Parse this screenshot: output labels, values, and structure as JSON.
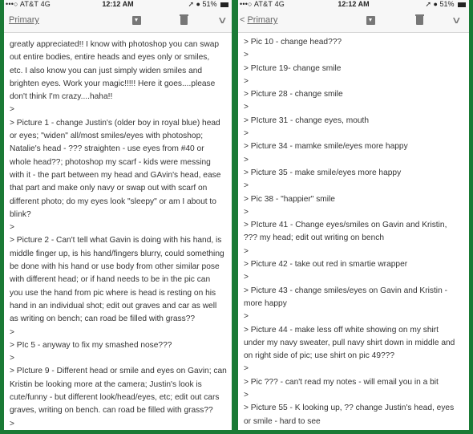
{
  "screens": [
    {
      "status_bar": {
        "carrier": "•••○ AT&T  4G",
        "time": "12:12 AM",
        "battery": "51%"
      },
      "nav": {
        "back_label": "Primary"
      },
      "lines": [
        "greatly appreciated!!  I know with photoshop you can swap",
        "out entire bodies, entire heads and eyes only or smiles,",
        "etc.  I also know you can just simply widen smiles and",
        "brighten eyes.  Work your magic!!!!!  Here it goes....please",
        "don't think I'm crazy....haha!!",
        ">",
        "> Picture 1 - change Justin's (older boy in royal blue) head",
        "or eyes; \"widen\" all/most smiles/eyes with photoshop;",
        "Natalie's head - ??? straighten - use eyes from #40 or",
        "whole head??; photoshop my scarf - kids were messing",
        "with it - the part between my head and GAvin's head, ease",
        "that part and make only navy or swap out with scarf on",
        "different photo; do my eyes look \"sleepy\" or am I about to",
        "blink?",
        ">",
        "> Picture 2 - Can't tell what Gavin is doing with his hand, is",
        "middle finger up, is his hand/fingers blurry, could something",
        "be done with his hand or use body from other similar pose",
        "with different head; or if hand needs to be in the pic can",
        "you use the hand from pic where is head is resting on his",
        "hand in an individual shot; edit out graves and car as well",
        "as writing on bench; can road be filled with grass??",
        ">",
        "> PIc 5 - anyway to fix my smashed nose???",
        ">",
        "> PIcture 9 - Different head or smile and eyes on Gavin; can",
        "Kristin be looking more at the camera; Justin's look is",
        "cute/funny - but different look/head/eyes, etc; edit out cars",
        "graves, writing on bench. can road be filled with grass??",
        ">"
      ]
    },
    {
      "status_bar": {
        "carrier": "•••○ AT&T  4G",
        "time": "12:12 AM",
        "battery": "51%"
      },
      "nav": {
        "back_label": "Primary"
      },
      "lines": [
        "> Pic 10 - change head???",
        ">",
        "> PIcture 19- change smile",
        ">",
        "> Picture 28 - change smile",
        ">",
        "> PIcture 31 - change eyes, mouth",
        ">",
        "> Picture 34 - mamke smile/eyes more happy",
        ">",
        "> Picture 35 - make smile/eyes more happy",
        ">",
        "> Pic 38 - \"happier\" smile",
        ">",
        "> PIcture 41 - Change eyes/smiles on Gavin and Kristin,",
        "??? my head; edit out writing on bench",
        ">",
        "> Picture 42 - take out red in smartie wrapper",
        ">",
        "> Picture 43 - change smiles/eyes on Gavin and Kristin -",
        "more happy",
        ">",
        "> Picture 44 - make less off white showing on my shirt",
        "under my navy sweater, pull navy shirt down in middle and",
        "on right side of pic; use shirt on pic 49???",
        ">",
        "> Pic ??? - can't read my notes - will email you in a bit",
        ">",
        "> Picture 55 - K looking up, ?? change Justin's head, eyes",
        "or smile - hard to see"
      ]
    }
  ],
  "icons": {
    "archive": "archive-icon",
    "trash": "trash-icon",
    "more": "chevron-down-icon",
    "back": "chevron-left-icon"
  },
  "colors": {
    "frame": "#1a7a35",
    "header_bg": "#f7f7f7",
    "text": "#333333"
  }
}
